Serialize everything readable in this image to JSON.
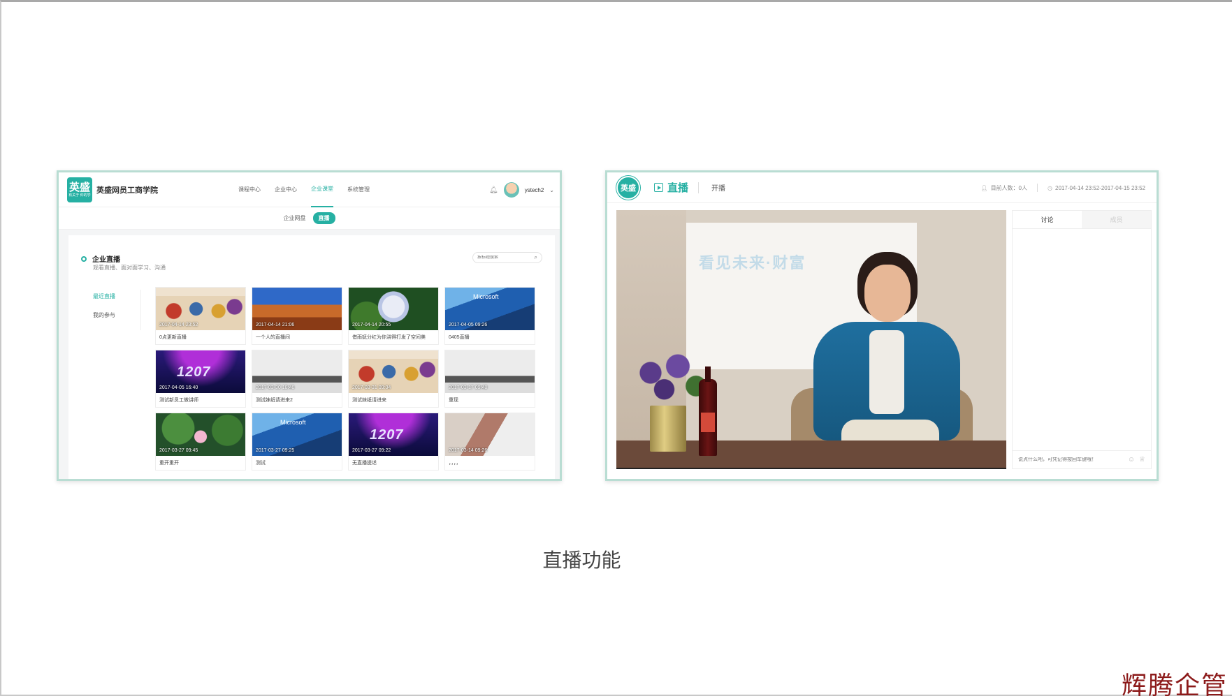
{
  "left_screen": {
    "logo_text": "英盛",
    "logo_subtext": "有关于 你的学",
    "school_name": "英盛网员工商学院",
    "nav": [
      "课程中心",
      "企业中心",
      "企业课堂",
      "系统管理"
    ],
    "nav_active_index": 2,
    "username": "ystech2",
    "subnav": [
      "企业网盘",
      "直播"
    ],
    "section_title": "企业直播",
    "section_subtitle": "观看直播、面对面学习、沟通",
    "search_placeholder": "按标题搜索",
    "side_menu": [
      "最近直播",
      "我的参与"
    ],
    "tiles": [
      {
        "time": "2017-04-14 23:52",
        "title": "0点更新直播",
        "thumb": "crowd"
      },
      {
        "time": "2017-04-14 21:06",
        "title": "一个人的直播间",
        "thumb": "desert"
      },
      {
        "time": "2017-04-14 20:55",
        "title": "借雨妩分红为你浇得打发了空间美",
        "thumb": "flower"
      },
      {
        "time": "2017-04-05 09:26",
        "title": "0405直播",
        "thumb": "microsoft"
      },
      {
        "time": "2017-04-05 16:40",
        "title": "测试新员工做讲师",
        "thumb": "stage"
      },
      {
        "time": "2017-03-30 18:46",
        "title": "测试妹纸请进来2",
        "thumb": "office"
      },
      {
        "time": "2017-03-31 09:04",
        "title": "测试妹纸请进来",
        "thumb": "crowd"
      },
      {
        "time": "2017-03-17 09:48",
        "title": "重现",
        "thumb": "office"
      },
      {
        "time": "2017-03-27 09:45",
        "title": "重开重开",
        "thumb": "lotus"
      },
      {
        "time": "2017-03-27 09:25",
        "title": "测试",
        "thumb": "microsoft"
      },
      {
        "time": "2017-03-27 09:22",
        "title": "无直播提述",
        "thumb": "stage"
      },
      {
        "time": "2017-03-14 09:26",
        "title": "，，，，",
        "thumb": "table"
      }
    ],
    "stage_number": "1207",
    "ms_word": "Microsoft"
  },
  "right_screen": {
    "logo_text": "英盛",
    "title": "直播",
    "start_label": "开播",
    "viewers": "目前人数：0人",
    "time_range": "2017-04-14 23:52-2017-04-15 23:52",
    "screen_text": "看见未来·财富",
    "chat_tabs": [
      "讨论",
      "成员"
    ],
    "chat_placeholder": "说点什么吧，可凭记得按回车键哦！"
  },
  "caption": "直播功能",
  "watermark": "辉腾企管",
  "colors": {
    "accent": "#26b0a3",
    "watermark": "#8c1a1a"
  },
  "icons": [
    "bell-icon",
    "search-icon",
    "play-icon",
    "person-icon",
    "clock-icon",
    "emoji-icon",
    "gift-icon",
    "chevron-down-icon"
  ]
}
